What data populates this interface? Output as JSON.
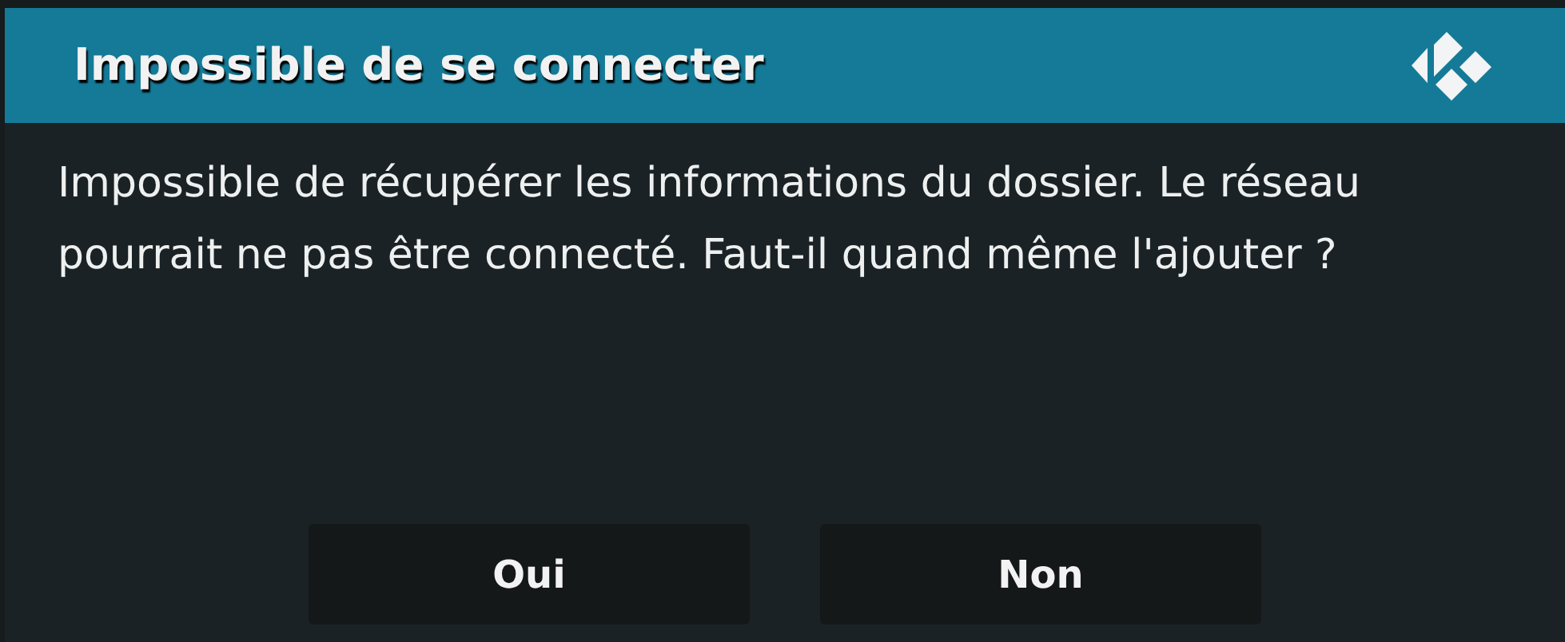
{
  "dialog": {
    "title": "Impossible de se connecter",
    "message": "Impossible de récupérer les informations du dossier. Le réseau pourrait ne pas être connecté. Faut-il quand même l'ajouter ?",
    "buttons": [
      {
        "label": "Oui"
      },
      {
        "label": "Non"
      }
    ]
  }
}
